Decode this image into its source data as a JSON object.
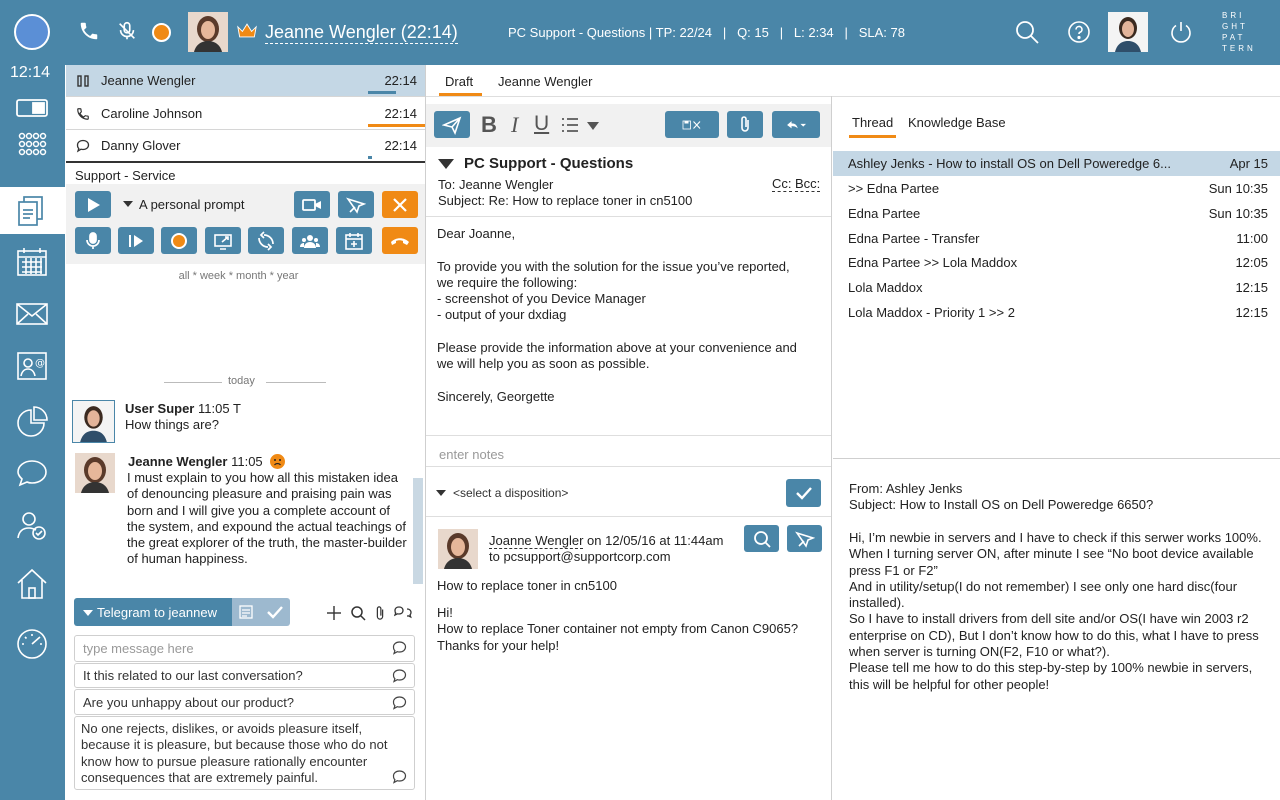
{
  "topbar": {
    "agent_name": "Jeanne Wengler (22:14)",
    "queue_status": "PC Support - Questions | TP: 22/24   |   Q: 15   |   L: 2:34   |   SLA: 78",
    "brand": [
      "BRI",
      "GHT",
      "PAT",
      "TERN"
    ],
    "record_color": "#f08a15",
    "crown_color": "#f08a15"
  },
  "rail": {
    "clock": "12:14"
  },
  "conversations": [
    {
      "name": "Jeanne Wengler",
      "time": "22:14",
      "icon": "pause-icon"
    },
    {
      "name": "Caroline Johnson",
      "time": "22:14",
      "icon": "phone-icon"
    },
    {
      "name": "Danny Glover",
      "time": "22:14",
      "icon": "chat-icon"
    }
  ],
  "service": {
    "title": "Support - Service",
    "prompt_label": "A personal prompt",
    "date_filter": "all * week * month * year",
    "today": "today"
  },
  "chat": {
    "messages": [
      {
        "author": "User Super",
        "time": "11:05 T",
        "text": "How things are?"
      },
      {
        "author": "Jeanne Wengler",
        "time": "11:05",
        "text": "I must explain to you how all this mistaken idea of denouncing pleasure and praising pain was born and I will give you a complete account of the system, and expound the actual teachings of the great explorer of the truth, the master-builder of human happiness."
      }
    ],
    "telegram_label": "Telegram to jeannew",
    "input_placeholder": "type message here",
    "quick_replies": [
      "It this related to our last conversation?",
      "Are you unhappy about our product?",
      "No one rejects, dislikes, or avoids pleasure itself, because it is pleasure, but because those who do not know how to pursue pleasure rationally encounter consequences that are extremely painful."
    ]
  },
  "email": {
    "tabs": [
      "Draft",
      "Jeanne Wengler"
    ],
    "queue_title": "PC Support - Questions",
    "to_line": "To: Jeanne Wengler",
    "cc": "Cc:",
    "bcc": "Bcc:",
    "subject_line": "Subject: Re: How to replace toner in cn5100",
    "body": "Dear Joanne,\n\nTo provide you with the solution for the issue you’ve reported,\nwe require the following:\n- screenshot of you Device Manager\n- output of your dxdiag\n\nPlease provide the information above at your convenience and\nwe will help you as soon as possible.\n\nSincerely, Georgette",
    "notes_placeholder": "enter notes",
    "disposition_placeholder": "<select a disposition>",
    "original": {
      "author": "Joanne Wengler",
      "date": " on 12/05/16 at 11:44am",
      "to": "to pcsupport@supportcorp.com",
      "subject": "How to replace toner in cn5100",
      "body": "Hi!\nHow to replace Toner container not empty from Canon C9065?\nThanks for your help!"
    }
  },
  "thread": {
    "tabs": [
      "Thread",
      "Knowledge Base"
    ],
    "items": [
      {
        "title": "Ashley Jenks - How to install OS on Dell Poweredge 6...",
        "date": "Apr 15"
      },
      {
        "title": ">> Edna Partee",
        "date": "Sun 10:35"
      },
      {
        "title": "Edna Partee",
        "date": "Sun 10:35"
      },
      {
        "title": "Edna Partee - Transfer",
        "date": "11:00"
      },
      {
        "title": "Edna Partee >> Lola Maddox",
        "date": "12:05"
      },
      {
        "title": "Lola Maddox",
        "date": "12:15"
      },
      {
        "title": "Lola Maddox - Priority 1 >> 2",
        "date": "12:15"
      }
    ],
    "preview": {
      "from": "From: Ashley Jenks",
      "subject": "Subject: How to Install OS on Dell Poweredge 6650?",
      "body": "Hi, I’m newbie in servers and I have to check if this serwer works 100%.\nWhen I turning server ON, after minute I see “No boot device available press F1 or F2”\nAnd in utility/setup(I do not remember) I see only one hard disc(four installed).\nSo I have to install drivers from dell site and/or OS(I have win 2003 r2 enterprise on CD), But I don’t know how to do this, what I have to press when server is turning ON(F2, F10 or what?).\nPlease tell me how to do this step-by-step by 100% newbie in servers, this will be helpful for other people!"
    }
  },
  "colors": {
    "accent": "#4a86a8",
    "orange": "#f08a15",
    "active_row": "#c4d7e5"
  }
}
